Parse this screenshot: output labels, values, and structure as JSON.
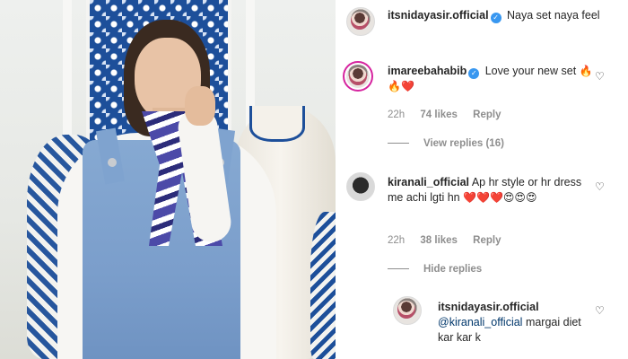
{
  "post": {
    "author": "itsnidayasir.official",
    "caption": "Naya set naya feel"
  },
  "comments": [
    {
      "username": "imareebahabib",
      "verified": true,
      "text": "Love your new set",
      "emoji": "🔥🔥❤️",
      "time": "22h",
      "likes": "74 likes",
      "reply_label": "Reply",
      "view_replies": "View replies (16)"
    },
    {
      "username": "kiranali_official",
      "verified": false,
      "text": "Ap hr style or hr dress me achi lgti hn",
      "emoji": "❤️❤️❤️😍😍😍",
      "time": "22h",
      "likes": "38 likes",
      "reply_label": "Reply",
      "hide_replies": "Hide replies"
    }
  ],
  "reply": {
    "username": "itsnidayasir.official",
    "mention": "@kiranali_official",
    "text": "margai diet kar kar k"
  },
  "icons": {
    "verified": "verified-badge-icon",
    "like": "heart-outline-icon"
  },
  "colors": {
    "verified": "#3897f0",
    "muted": "#8e8e8e",
    "mention": "#00376b"
  }
}
